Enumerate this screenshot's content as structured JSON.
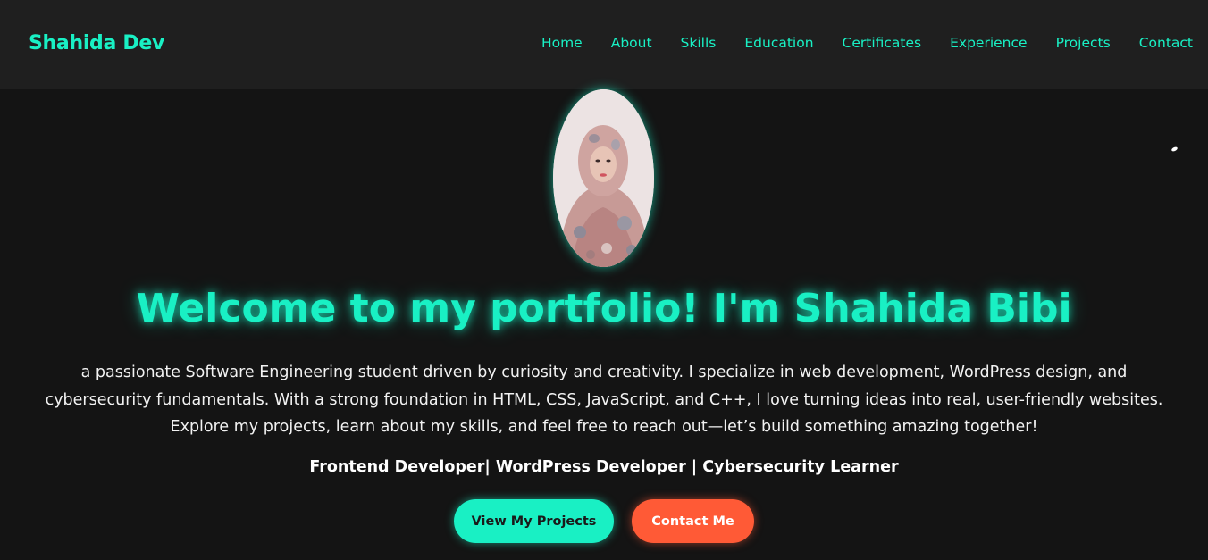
{
  "navbar": {
    "brand": "Shahida Dev",
    "links": [
      "Home",
      "About",
      "Skills",
      "Education",
      "Certificates",
      "Experience",
      "Projects",
      "Contact"
    ]
  },
  "hero": {
    "title": "Welcome to my portfolio! I'm Shahida Bibi",
    "description": "a passionate Software Engineering student driven by curiosity and creativity. I specialize in web development, WordPress design, and cybersecurity fundamentals. With a strong foundation in HTML, CSS, JavaScript, and C++, I love turning ideas into real, user-friendly websites. Explore my projects, learn about my skills, and feel free to reach out—let’s build something amazing together!",
    "roles": "Frontend Developer| WordPress Developer | Cybersecurity Learner",
    "buttons": {
      "projects": "View My Projects",
      "contact": "Contact Me"
    }
  },
  "colors": {
    "accent": "#19f0c4",
    "contact_button": "#ff5a36",
    "background": "#141414",
    "navbar_background": "#1f1f1f"
  }
}
